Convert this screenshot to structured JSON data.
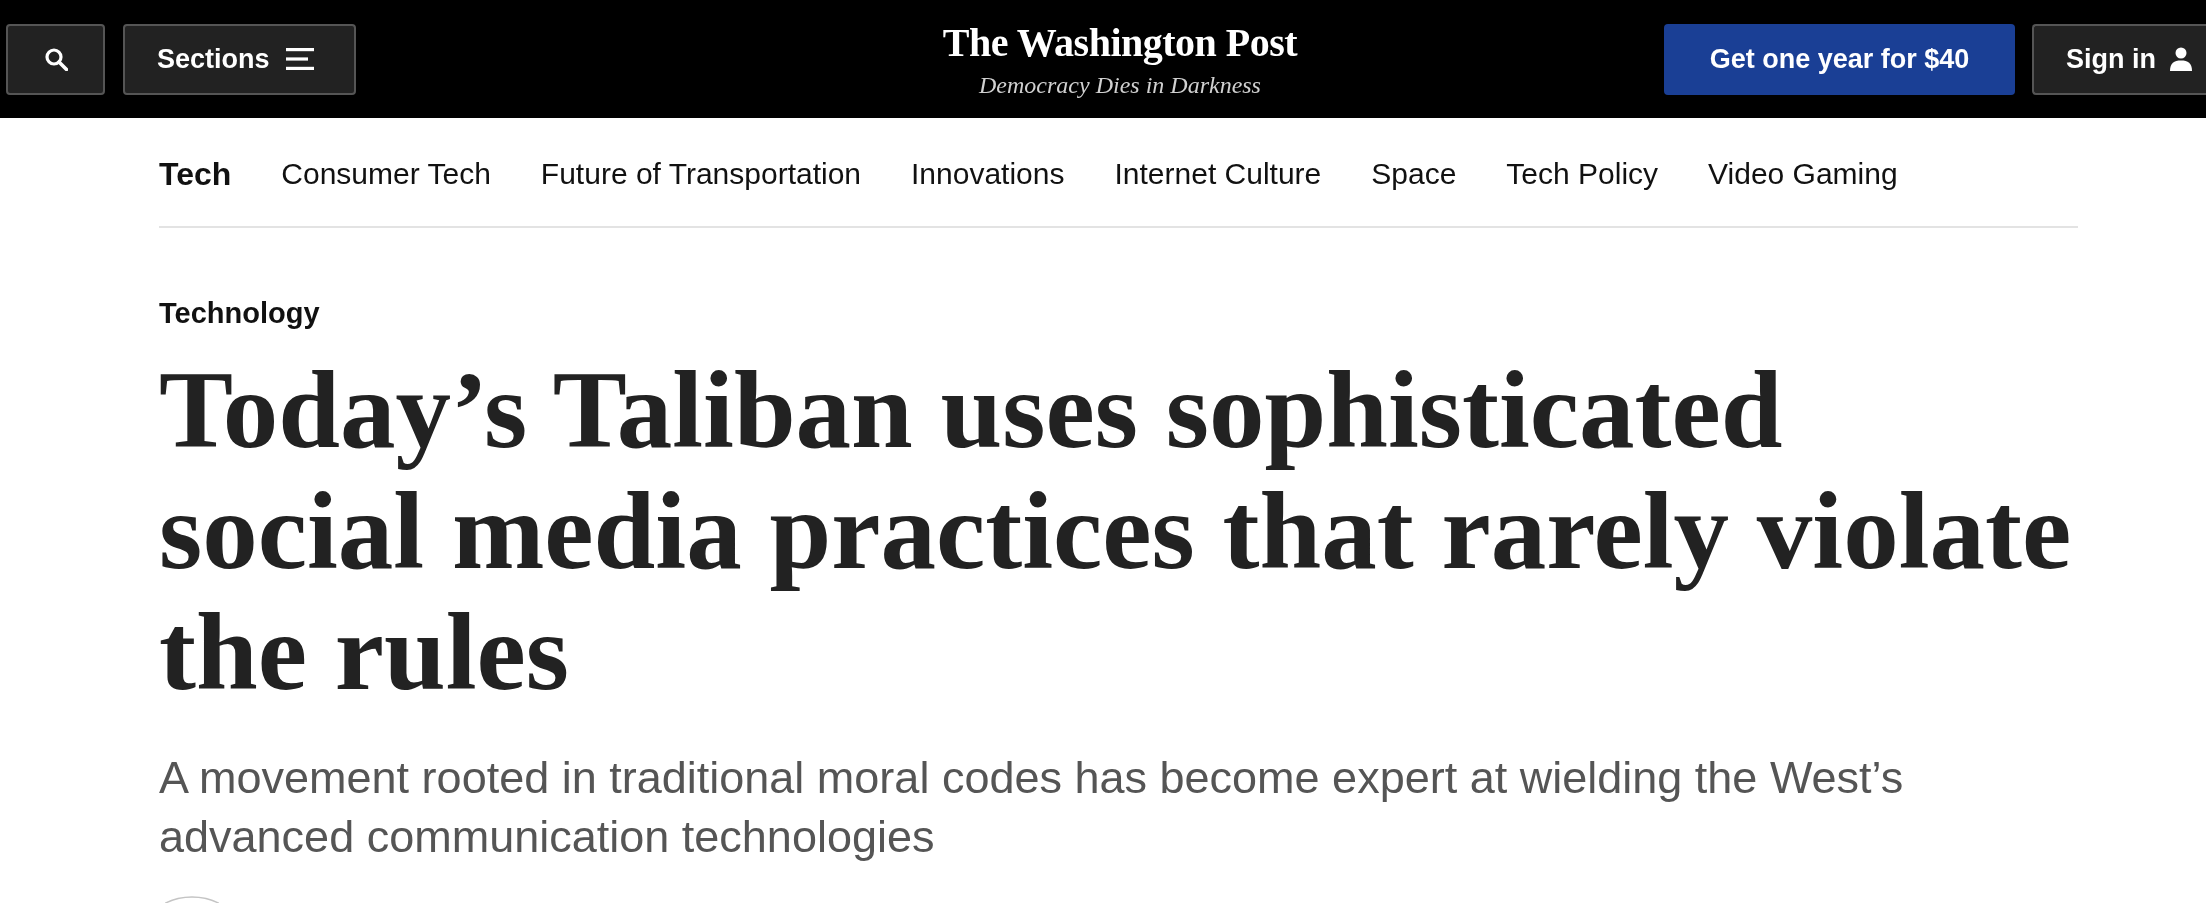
{
  "header": {
    "sections_button": {
      "label": "Sections"
    },
    "logo": {
      "name": "The Washington Post",
      "tagline": "Democracy Dies in Darkness"
    },
    "subscribe_button": {
      "label": "Get one year for $40"
    },
    "sign_in_button": {
      "label": "Sign in"
    }
  },
  "nav": {
    "title": "Tech",
    "items": [
      "Consumer Tech",
      "Future of Transportation",
      "Innovations",
      "Internet Culture",
      "Space",
      "Tech Policy",
      "Video Gaming"
    ]
  },
  "article": {
    "kicker": "Technology",
    "headline": "Today’s Taliban uses sophisticated social media practices that rarely violate the rules",
    "dek": "A movement rooted in traditional moral codes has become expert at wielding the West’s advanced communication technologies"
  }
}
